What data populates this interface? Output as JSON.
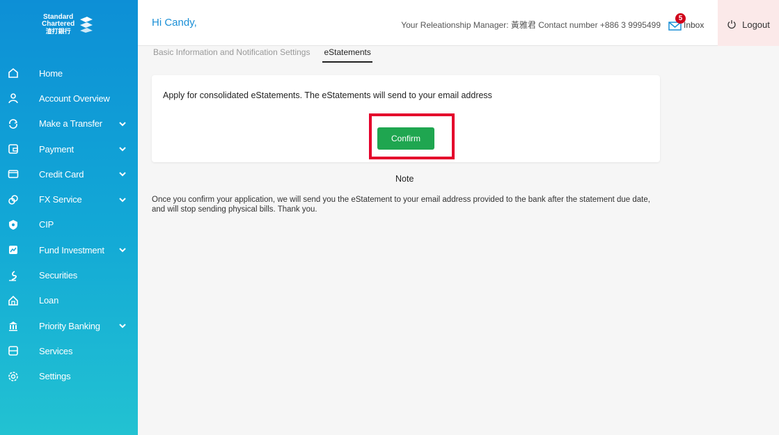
{
  "brand": {
    "line1": "Standard",
    "line2": "Chartered",
    "line3": "渣打銀行"
  },
  "sidebar": {
    "items": [
      {
        "label": "Home",
        "icon": "home-icon",
        "chevron": false
      },
      {
        "label": "Account Overview",
        "icon": "user-icon",
        "chevron": false
      },
      {
        "label": "Make a Transfer",
        "icon": "transfer-icon",
        "chevron": true
      },
      {
        "label": "Payment",
        "icon": "wallet-icon",
        "chevron": true
      },
      {
        "label": "Credit Card",
        "icon": "credit-card-icon",
        "chevron": true
      },
      {
        "label": "FX Service",
        "icon": "fx-icon",
        "chevron": true
      },
      {
        "label": "CIP",
        "icon": "cip-icon",
        "chevron": false
      },
      {
        "label": "Fund Investment",
        "icon": "fund-icon",
        "chevron": true
      },
      {
        "label": "Securities",
        "icon": "securities-icon",
        "chevron": false
      },
      {
        "label": "Loan",
        "icon": "loan-icon",
        "chevron": false
      },
      {
        "label": "Priority Banking",
        "icon": "priority-icon",
        "chevron": true
      },
      {
        "label": "Services",
        "icon": "services-icon",
        "chevron": false
      },
      {
        "label": "Settings",
        "icon": "settings-icon",
        "chevron": false
      }
    ]
  },
  "header": {
    "greeting": "Hi Candy,",
    "relationship_manager": "Your Releationship Manager: 黃雅君 Contact number +886 3 9995499",
    "inbox_label": "Inbox",
    "inbox_count": "5",
    "logout_label": "Logout"
  },
  "tabs": [
    {
      "label": "Basic Information and Notification Settings",
      "active": false
    },
    {
      "label": "eStatements",
      "active": true
    }
  ],
  "main": {
    "card_text": "Apply for consolidated eStatements. The eStatements will send to your email address",
    "confirm_label": "Confirm",
    "note_title": "Note",
    "note_body": "Once you confirm your application, we will send you the eStatement to your email address provided to the bank after the statement due date, and will stop sending physical bills. Thank you."
  },
  "colors": {
    "accent": "#1a8fd6",
    "confirm": "#1fa650",
    "highlight": "#e4002b",
    "badge": "#d0021b"
  }
}
